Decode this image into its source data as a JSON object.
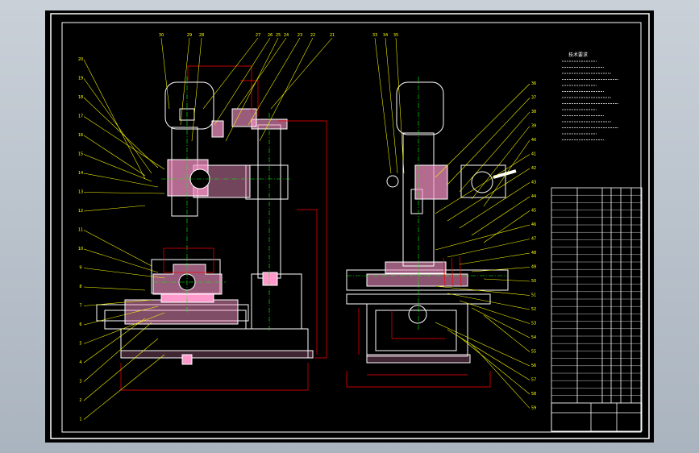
{
  "colors": {
    "viewport_bg": "#b8c1cb",
    "sheet_bg": "#000000",
    "border": "#ffffff",
    "leader": "#ffff00",
    "part_fill": "#ff99cc",
    "dimension": "#ff0000",
    "centerline": "#00ff00",
    "outline": "#ffffff"
  },
  "drawing": {
    "type": "cad-assembly-drawing",
    "front_view_balloons_left": [
      "20",
      "19",
      "18",
      "17",
      "16",
      "15",
      "14",
      "13",
      "12",
      "11",
      "10",
      "9",
      "8",
      "7",
      "6",
      "5",
      "4",
      "3",
      "2",
      "1"
    ],
    "front_view_balloons_top": [
      "30",
      "29",
      "28",
      "27",
      "26",
      "25",
      "24",
      "23",
      "22",
      "21"
    ],
    "side_view_balloons_top": [
      "33",
      "34",
      "35"
    ],
    "side_view_balloons_right": [
      "36",
      "37",
      "38",
      "39",
      "40",
      "41",
      "42",
      "43",
      "44",
      "45",
      "46",
      "47",
      "48",
      "49",
      "50",
      "51",
      "52",
      "53",
      "54",
      "55",
      "56",
      "57",
      "58",
      "59"
    ]
  },
  "notes_title": "技术要求",
  "icons": [
    "cad-sheet-icon"
  ]
}
